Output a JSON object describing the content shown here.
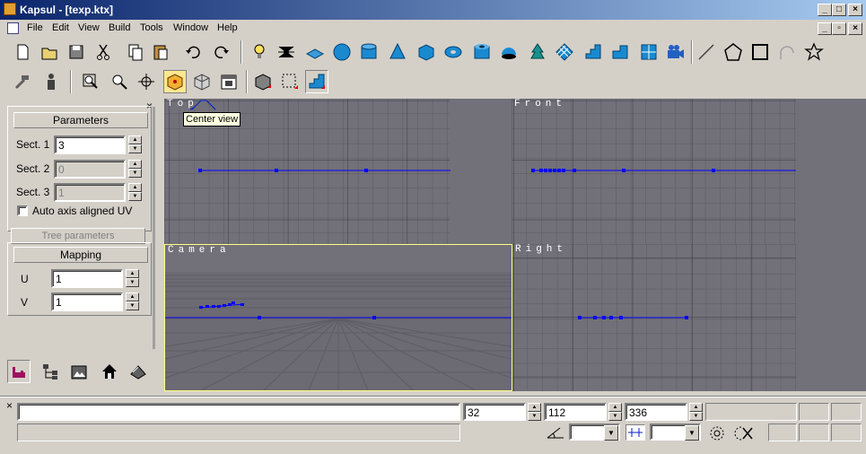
{
  "window": {
    "title": "Kapsul - [texp.ktx]"
  },
  "menu": [
    "File",
    "Edit",
    "View",
    "Build",
    "Tools",
    "Window",
    "Help"
  ],
  "toolbar": {
    "row1": [
      "new-icon",
      "open-icon",
      "save-icon",
      "cut-icon",
      "copy-icon",
      "paste-icon",
      "undo-icon",
      "redo-icon",
      "light-bulb-icon",
      "spider-icon",
      "plane-icon",
      "sphere-icon",
      "cylinder-icon",
      "cone-icon",
      "cube-icon",
      "torus-icon",
      "tube-icon",
      "hemisphere-icon",
      "tree-icon",
      "grid-plane-icon",
      "stairs-icon",
      "steps-icon",
      "cube-stack-icon",
      "camera-icon",
      "line-icon",
      "pentagon-icon",
      "square-icon",
      "arc-icon",
      "star-icon"
    ],
    "row2": [
      "hammer-icon",
      "person-icon",
      "zoom-region-icon",
      "zoom-icon",
      "pan-icon",
      "center-view-icon",
      "views-icon",
      "frame-icon",
      "object-icon",
      "selection-icon",
      "stairs-active-icon"
    ]
  },
  "tooltip": "Center view",
  "parameters": {
    "header": "Parameters",
    "sect1_label": "Sect. 1",
    "sect1_value": "3",
    "sect2_label": "Sect. 2",
    "sect2_value": "0",
    "sect3_label": "Sect. 3",
    "sect3_value": "1",
    "auto_uv_label": "Auto axis aligned UV"
  },
  "tree_parameters": {
    "header": "Tree parameters"
  },
  "mapping": {
    "header": "Mapping",
    "u_label": "U",
    "u_value": "1",
    "v_label": "V",
    "v_value": "1"
  },
  "viewports": {
    "top": "Top",
    "front": "Front",
    "camera": "Camera",
    "right": "Right"
  },
  "status": {
    "command_value": "",
    "x_value": "32",
    "y_value": "112",
    "z_value": "336",
    "angle_value": "",
    "snap_value": ""
  },
  "colors": {
    "accent": "#0a246a",
    "viewport_bg": "#727079",
    "vertex": "#0000ff",
    "camera_border": "#ffff80"
  }
}
